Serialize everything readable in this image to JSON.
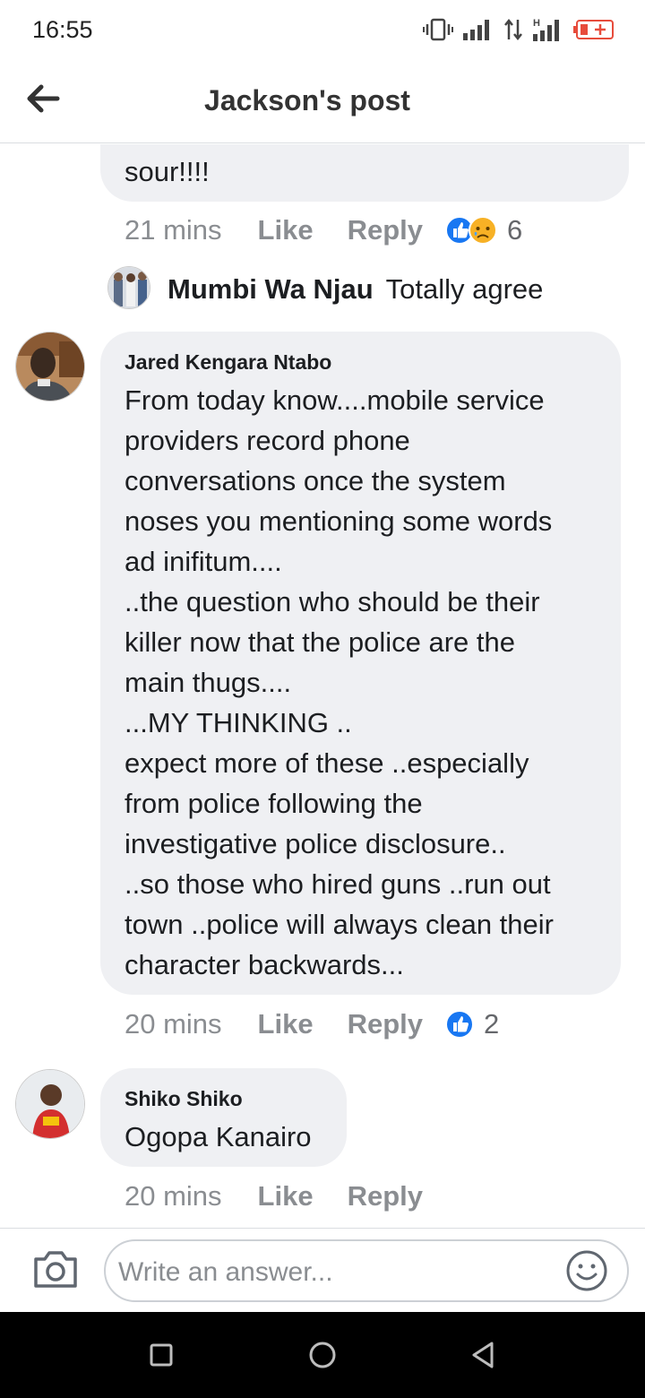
{
  "status_bar": {
    "time": "16:55"
  },
  "header": {
    "title": "Jackson's post"
  },
  "comments": {
    "top_partial": {
      "text": "sour!!!!",
      "time": "21 mins",
      "like_label": "Like",
      "reply_label": "Reply",
      "reaction_count": "6",
      "reply_author": "Mumbi Wa Njau",
      "reply_text": "Totally agree"
    },
    "jared": {
      "author": "Jared Kengara Ntabo",
      "text": "From today know....mobile service\nproviders record phone\nconversations once the system\nnoses you mentioning some words\nad inifitum....\n..the question who should be their\nkiller now that the police are the\nmain thugs....\n...MY THINKING ..\nexpect more of these ..especially\nfrom police following the\ninvestigative police disclosure..\n..so those who hired guns ..run out\ntown ..police will always clean their\ncharacter backwards...",
      "time": "20 mins",
      "like_label": "Like",
      "reply_label": "Reply",
      "reaction_count": "2"
    },
    "shiko": {
      "author": "Shiko Shiko",
      "text": "Ogopa Kanairo",
      "time": "20 mins",
      "like_label": "Like",
      "reply_label": "Reply"
    }
  },
  "composer": {
    "placeholder": "Write an answer..."
  },
  "colors": {
    "like_blue": "#1877f2",
    "bubble_bg": "#eff0f3",
    "meta_gray": "#8a8d91"
  },
  "icons": [
    "back-arrow-icon",
    "camera-icon",
    "emoji-icon",
    "like-reaction-icon",
    "sad-reaction-icon",
    "nav-square-icon",
    "nav-circle-icon",
    "nav-back-icon"
  ]
}
